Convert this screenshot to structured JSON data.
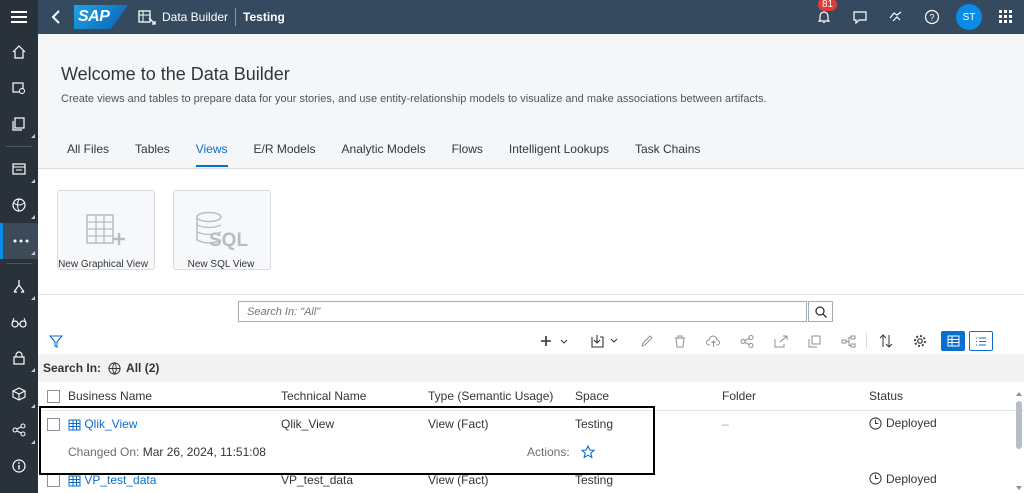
{
  "shell": {
    "logo": "SAP",
    "app_title": "Data Builder",
    "space_title": "Testing",
    "notification_count": "81",
    "avatar_initials": "ST"
  },
  "hero": {
    "title": "Welcome to the Data Builder",
    "description": "Create views and tables to prepare data for your stories, and use entity-relationship models to visualize and make associations between artifacts."
  },
  "tabs": [
    "All Files",
    "Tables",
    "Views",
    "E/R Models",
    "Analytic Models",
    "Flows",
    "Intelligent Lookups",
    "Task Chains"
  ],
  "active_tab": "Views",
  "tiles": {
    "graphical": "New Graphical View",
    "sql": "New SQL View",
    "sql_icon_text": "SQL"
  },
  "search": {
    "placeholder": "Search In: \"All\""
  },
  "search_in": {
    "label": "Search In:",
    "scope": "All (2)"
  },
  "columns": [
    "Business Name",
    "Technical Name",
    "Type (Semantic Usage)",
    "Space",
    "Folder",
    "Status"
  ],
  "rows": [
    {
      "business_name": "Qlik_View",
      "technical_name": "Qlik_View",
      "type": "View (Fact)",
      "space": "Testing",
      "folder": "–",
      "status": "Deployed",
      "changed_label": "Changed On:",
      "changed_value": "Mar 26, 2024, 11:51:08",
      "actions_label": "Actions:"
    },
    {
      "business_name": "VP_test_data",
      "technical_name": "VP_test_data",
      "type": "View (Fact)",
      "space": "Testing",
      "status": "Deployed"
    }
  ],
  "colors": {
    "shell": "#354a5f",
    "nav": "#29313a",
    "accent": "#0a6ed1"
  }
}
